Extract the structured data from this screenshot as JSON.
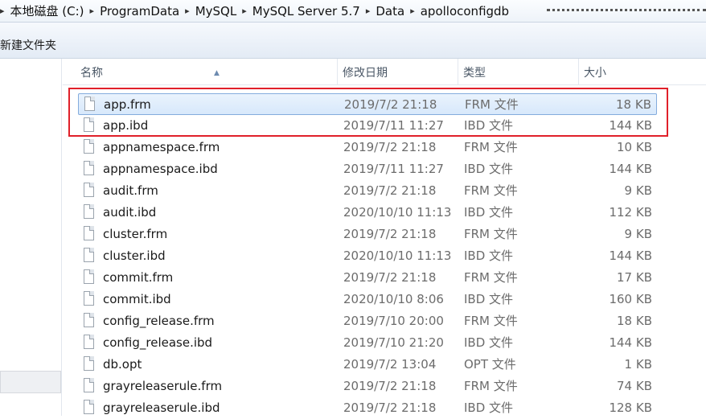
{
  "breadcrumb": [
    "本地磁盘 (C:)",
    "ProgramData",
    "MySQL",
    "MySQL Server 5.7",
    "Data",
    "apolloconfigdb"
  ],
  "toolbar": {
    "new_folder": "新建文件夹"
  },
  "columns": {
    "name": "名称",
    "date": "修改日期",
    "type": "类型",
    "size": "大小"
  },
  "colors": {
    "highlight": "#e0202a",
    "selection": "#d7e8fb"
  },
  "highlighted_rows": [
    0,
    1
  ],
  "selected_row": 0,
  "files": [
    {
      "name": "app.frm",
      "date": "2019/7/2 21:18",
      "type": "FRM 文件",
      "size": "18 KB"
    },
    {
      "name": "app.ibd",
      "date": "2019/7/11 11:27",
      "type": "IBD 文件",
      "size": "144 KB"
    },
    {
      "name": "appnamespace.frm",
      "date": "2019/7/2 21:18",
      "type": "FRM 文件",
      "size": "10 KB"
    },
    {
      "name": "appnamespace.ibd",
      "date": "2019/7/11 11:27",
      "type": "IBD 文件",
      "size": "144 KB"
    },
    {
      "name": "audit.frm",
      "date": "2019/7/2 21:18",
      "type": "FRM 文件",
      "size": "9 KB"
    },
    {
      "name": "audit.ibd",
      "date": "2020/10/10 11:13",
      "type": "IBD 文件",
      "size": "112 KB"
    },
    {
      "name": "cluster.frm",
      "date": "2019/7/2 21:18",
      "type": "FRM 文件",
      "size": "9 KB"
    },
    {
      "name": "cluster.ibd",
      "date": "2020/10/10 11:13",
      "type": "IBD 文件",
      "size": "144 KB"
    },
    {
      "name": "commit.frm",
      "date": "2019/7/2 21:18",
      "type": "FRM 文件",
      "size": "17 KB"
    },
    {
      "name": "commit.ibd",
      "date": "2020/10/10 8:06",
      "type": "IBD 文件",
      "size": "160 KB"
    },
    {
      "name": "config_release.frm",
      "date": "2019/7/10 20:00",
      "type": "FRM 文件",
      "size": "18 KB"
    },
    {
      "name": "config_release.ibd",
      "date": "2019/7/10 21:20",
      "type": "IBD 文件",
      "size": "144 KB"
    },
    {
      "name": "db.opt",
      "date": "2019/7/2 13:04",
      "type": "OPT 文件",
      "size": "1 KB"
    },
    {
      "name": "grayreleaserule.frm",
      "date": "2019/7/2 21:18",
      "type": "FRM 文件",
      "size": "74 KB"
    },
    {
      "name": "grayreleaserule.ibd",
      "date": "2019/7/2 21:18",
      "type": "IBD 文件",
      "size": "128 KB"
    }
  ]
}
